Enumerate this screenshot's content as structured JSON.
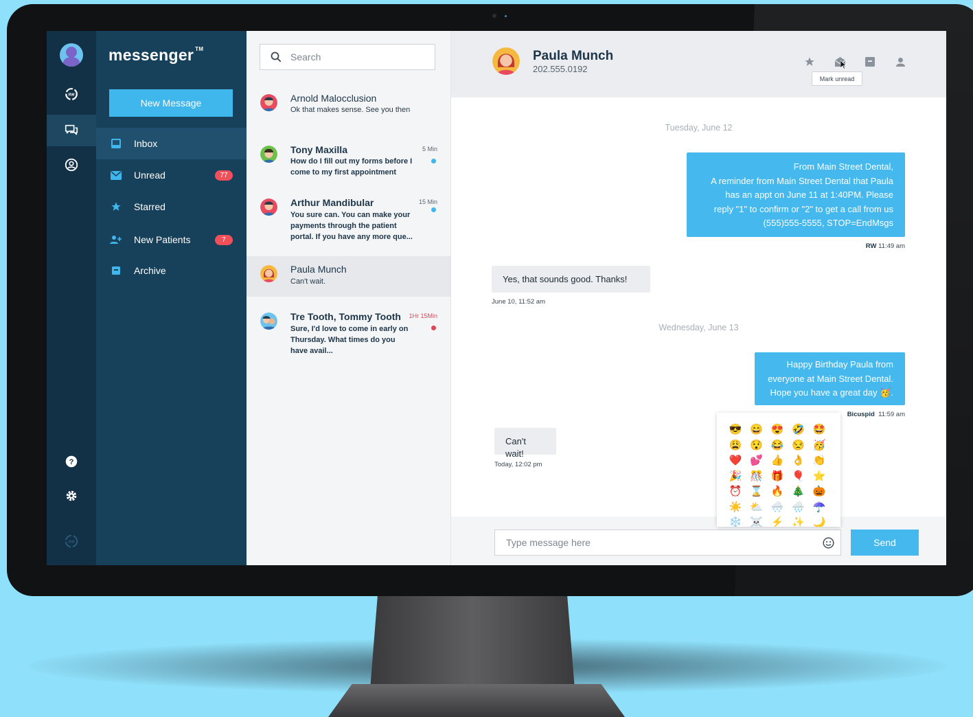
{
  "app": {
    "brand": "messenger",
    "brand_mark": "TM"
  },
  "rail": {
    "icons": [
      "avatar-icon",
      "rw-logo-icon",
      "chat-icon",
      "contacts-icon",
      "help-icon",
      "gear-icon",
      "rw-footer-logo-icon"
    ],
    "active": "chat-icon"
  },
  "nav": {
    "new_message_label": "New Message",
    "items": [
      {
        "label": "Inbox",
        "icon": "inbox-icon",
        "active": true,
        "badge": null
      },
      {
        "label": "Unread",
        "icon": "envelope-icon",
        "active": false,
        "badge": "77"
      },
      {
        "label": "Starred",
        "icon": "star-icon",
        "active": false,
        "badge": null
      },
      {
        "label": "New Patients",
        "icon": "add-user-icon",
        "active": false,
        "badge": "7"
      },
      {
        "label": "Archive",
        "icon": "archive-icon",
        "active": false,
        "badge": null
      }
    ]
  },
  "search": {
    "placeholder": "Search"
  },
  "conversations": [
    {
      "name": "Arnold Malocclusion",
      "snippet": "Ok that makes sense. See you then",
      "time": "",
      "unread": false,
      "dot": null,
      "selected": false
    },
    {
      "name": "Tony Maxilla",
      "snippet": "How do I fill out my forms before I come to my first appointment",
      "time": "5 Min",
      "unread": true,
      "dot": "#3fb6ec",
      "selected": false
    },
    {
      "name": "Arthur Mandibular",
      "snippet": "You sure can. You can make your payments through the patient portal. If you have any more que...",
      "time": "15 Min",
      "unread": true,
      "dot": "#3fb6ec",
      "selected": false
    },
    {
      "name": "Paula Munch",
      "snippet": "Can't wait.",
      "time": "",
      "unread": false,
      "dot": null,
      "selected": true
    },
    {
      "name": "Tre Tooth, Tommy Tooth",
      "snippet": "Sure, I'd love to come in early on Thursday. What times do you have avail...",
      "time": "1Hr 15Min",
      "unread": true,
      "dot": "#e0465a",
      "selected": false
    }
  ],
  "chat": {
    "contact_name": "Paula Munch",
    "contact_phone": "202.555.0192",
    "header_icons": [
      "star-icon",
      "mark-unread-icon",
      "archive-icon",
      "person-icon"
    ],
    "tooltip": "Mark unread",
    "day_1": "Tuesday, June 12",
    "msg_1_lines": [
      "From Main Street Dental,",
      "A reminder from Main Street Dental that Paula",
      "has an appt on June 11 at 1:40PM. Please",
      "reply \"1\" to confirm or  \"2\" to get a call from us",
      "(555)555-5555, STOP=EndMsgs"
    ],
    "msg_1_sender": "RW",
    "msg_1_time": "11:49 am",
    "msg_2": "Yes, that sounds good. Thanks!",
    "msg_2_time": "June 10, 11:52 am",
    "day_2": "Wednesday, June 13",
    "msg_3_lines": [
      "Happy Birthday Paula from",
      "everyone at Main Street Dental.",
      "Hope you have a great day 🥳."
    ],
    "msg_3_sender": "Bicuspid",
    "msg_3_time": "11:59 am",
    "msg_4": "Can't wait!",
    "msg_4_time": "Today, 12:02 pm",
    "emoji_picker": [
      "😎",
      "😄",
      "😍",
      "🤣",
      "🤩",
      "😩",
      "😯",
      "😂",
      "😒",
      "🥳",
      "❤️",
      "💕",
      "👍",
      "👌",
      "👏",
      "🎉",
      "🎊",
      "🎁",
      "🎈",
      "⭐",
      "⏰",
      "⌛",
      "🔥",
      "🎄",
      "🎃",
      "☀️",
      "⛅",
      "🌨️",
      "🌧️",
      "☂️",
      "❄️",
      "☠️",
      "⚡",
      "✨",
      "🌙"
    ],
    "input_placeholder": "Type message here",
    "send_label": "Send"
  },
  "colors": {
    "rail": "#123146",
    "nav": "#17405a",
    "accent": "#45b9ed",
    "badge": "#f0505a"
  }
}
